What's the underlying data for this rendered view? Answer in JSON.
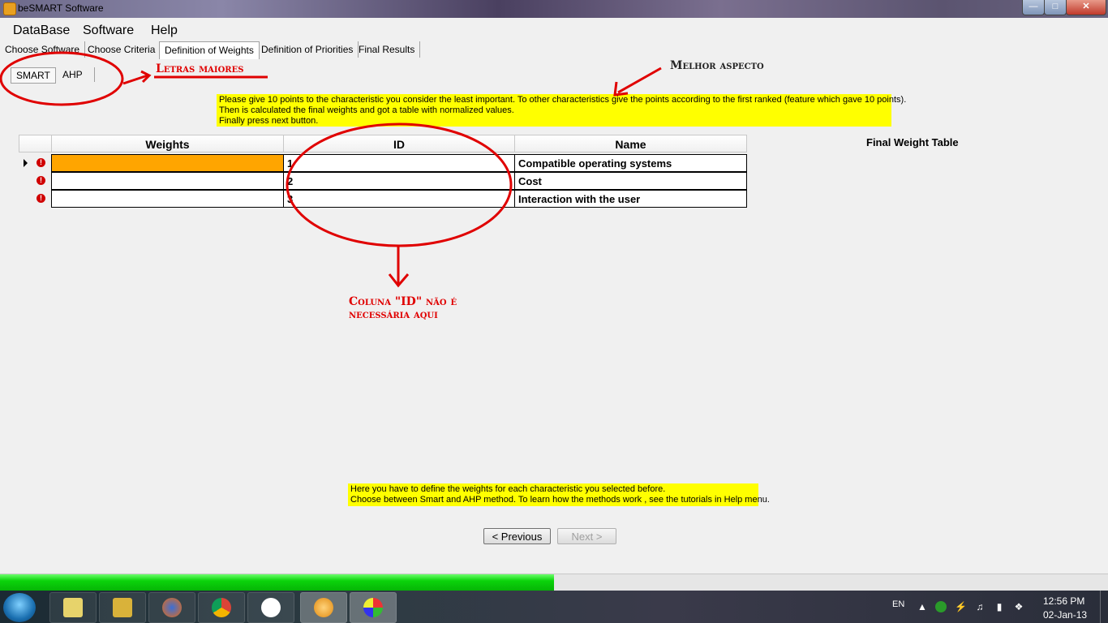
{
  "window": {
    "title": "beSMART Software",
    "min_icon": "minimize-icon",
    "max_icon": "maximize-icon",
    "close_icon": "close-icon"
  },
  "menu": [
    "DataBase",
    "Software",
    "Help"
  ],
  "tabs": [
    "Choose Software",
    "Choose Criteria",
    "Definition of Weights",
    "Definition of Priorities",
    "Final Results"
  ],
  "active_tab": "Definition of Weights",
  "subtabs": [
    "SMART",
    "AHP"
  ],
  "instructions": [
    "Please give 10 points to the  characteristic you consider the least important. To other characteristics give the points according to the first ranked (feature which gave 10 points).",
    "Then is calculated the final weights and got a  table with normalized values.",
    "Finally press next button."
  ],
  "final_weight_title": "Final Weight Table",
  "grid": {
    "columns": [
      "Weights",
      "ID",
      "Name"
    ],
    "rows": [
      {
        "weight": "",
        "id": "1",
        "name": "Compatible operating systems",
        "error": true,
        "selected": true
      },
      {
        "weight": "",
        "id": "2",
        "name": "Cost",
        "error": true,
        "selected": false
      },
      {
        "weight": "",
        "id": "3",
        "name": "Interaction with the user",
        "error": true,
        "selected": false
      }
    ]
  },
  "help_notes": [
    "Here you have to define the weights for each characteristic you selected before.",
    "Choose between Smart and AHP method. To learn how the methods work , see the tutorials in Help menu."
  ],
  "buttons": {
    "previous": "< Previous",
    "next": "Next >"
  },
  "progress": {
    "value": 0.5
  },
  "annotations": {
    "letras": "Letras maiores",
    "melhor": "Melhor aspecto",
    "coluna_line1": "Coluna \"ID\" não é",
    "coluna_line2": "necessária aqui"
  },
  "taskbar": {
    "apps": [
      "explorer-icon",
      "folder-icon",
      "firefox-icon",
      "chrome-icon",
      "fox-icon",
      "besmart-icon",
      "paint-icon"
    ],
    "lang": "EN",
    "time": "12:56 PM",
    "date": "02-Jan-13"
  },
  "colors": {
    "yellow": "#ffff00",
    "orange_cell": "#ffa500",
    "annotation_red": "#e00000",
    "progress_green": "#06b506"
  }
}
